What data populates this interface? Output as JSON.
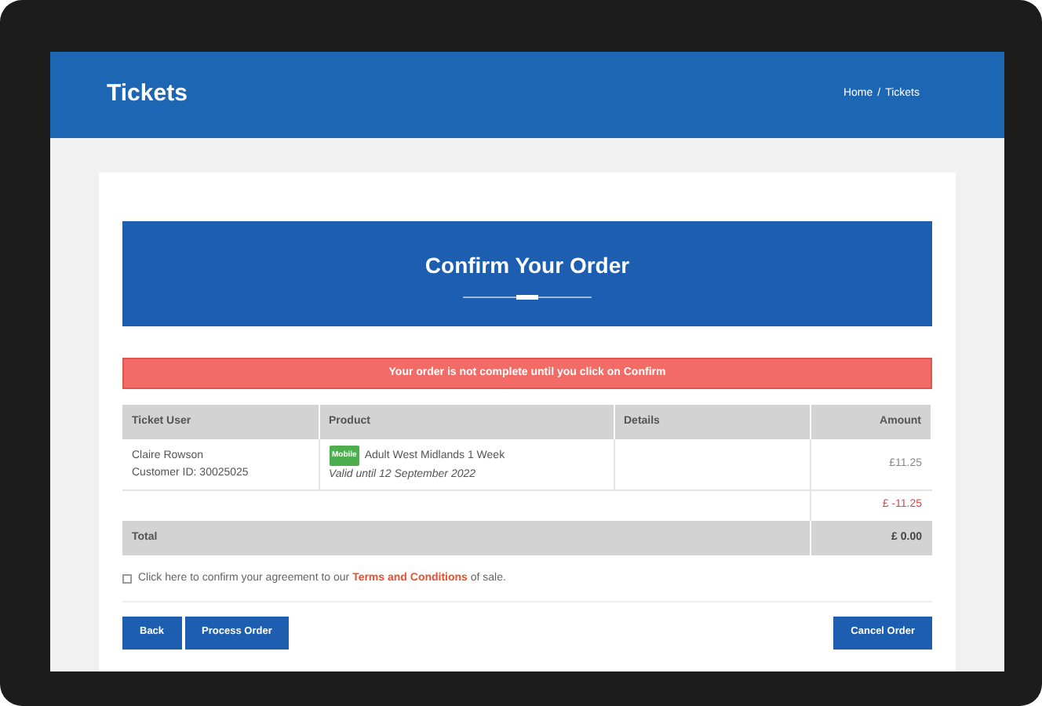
{
  "header": {
    "title": "Tickets",
    "breadcrumb": [
      {
        "label": "Home"
      },
      {
        "label": "Tickets"
      }
    ],
    "separator": "/"
  },
  "banner": {
    "title": "Confirm Your Order"
  },
  "alert": "Your order is not complete until you click on Confirm",
  "table": {
    "columns": [
      "Ticket User",
      "Product",
      "Details",
      "Amount"
    ],
    "rows": [
      {
        "user": "Claire Rowson",
        "customer_id": "Customer ID: 30025025",
        "badge": "Mobile",
        "product": "Adult West Midlands 1 Week",
        "validity": "Valid until 12 September 2022",
        "amount": "£11.25"
      }
    ],
    "discount": "£ -11.25",
    "total_label": "Total",
    "total": "£ 0.00"
  },
  "agreement": {
    "checked": false,
    "text": "Click here to confirm your agreement to our",
    "link": "Terms and Conditions",
    "suffix": "of sale."
  },
  "buttons_left": [
    "Back",
    "Process Order"
  ],
  "buttons_right": [
    "Cancel Order"
  ]
}
